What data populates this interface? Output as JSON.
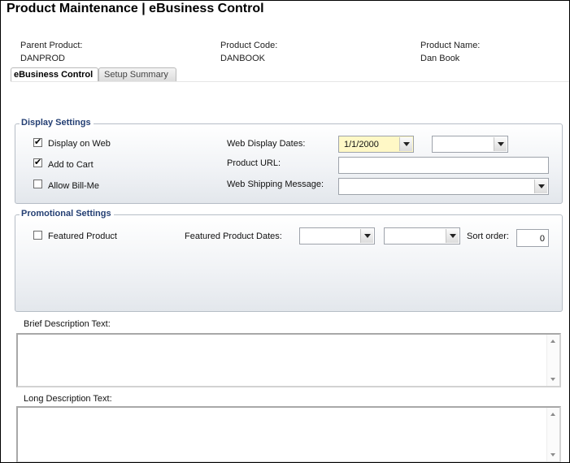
{
  "header": {
    "title": "Product Maintenance  |  eBusiness Control",
    "parent_product_label": "Parent Product:",
    "parent_product_value": "DANPROD",
    "product_code_label": "Product Code:",
    "product_code_value": "DANBOOK",
    "product_name_label": "Product Name:",
    "product_name_value": "Dan Book"
  },
  "tabs": [
    {
      "label": "eBusiness Control",
      "active": true
    },
    {
      "label": "Setup Summary",
      "active": false
    }
  ],
  "display_settings": {
    "legend": "Display Settings",
    "display_on_web": {
      "label": "Display on Web",
      "checked": true,
      "mark": "✔"
    },
    "add_to_cart": {
      "label": "Add to Cart",
      "checked": true,
      "mark": "✔"
    },
    "allow_bill_me": {
      "label": "Allow Bill-Me",
      "checked": false,
      "mark": ""
    },
    "web_display_dates_label": "Web Display Dates:",
    "web_display_start": "1/1/2000",
    "web_display_end": "",
    "product_url_label": "Product URL:",
    "product_url_value": "",
    "web_shipping_message_label": "Web Shipping Message:",
    "web_shipping_message_value": ""
  },
  "promotional_settings": {
    "legend": "Promotional Settings",
    "featured_product": {
      "label": "Featured Product",
      "checked": false,
      "mark": ""
    },
    "featured_product_dates_label": "Featured Product Dates:",
    "featured_start": "",
    "featured_end": "",
    "sort_order_label": "Sort order:",
    "sort_order_value": "0"
  },
  "brief_description": {
    "label": "Brief Description Text:",
    "value": ""
  },
  "long_description": {
    "label": "Long Description Text:",
    "value": ""
  },
  "colors": {
    "legend_text": "#243f73",
    "highlight_field": "#fff8c6",
    "group_border": "#b6bdc6"
  },
  "icons": {
    "dropdown": "chevron-down-icon",
    "checkbox_checked": "check-icon",
    "scroll_up": "scroll-up-icon",
    "scroll_down": "scroll-down-icon"
  }
}
